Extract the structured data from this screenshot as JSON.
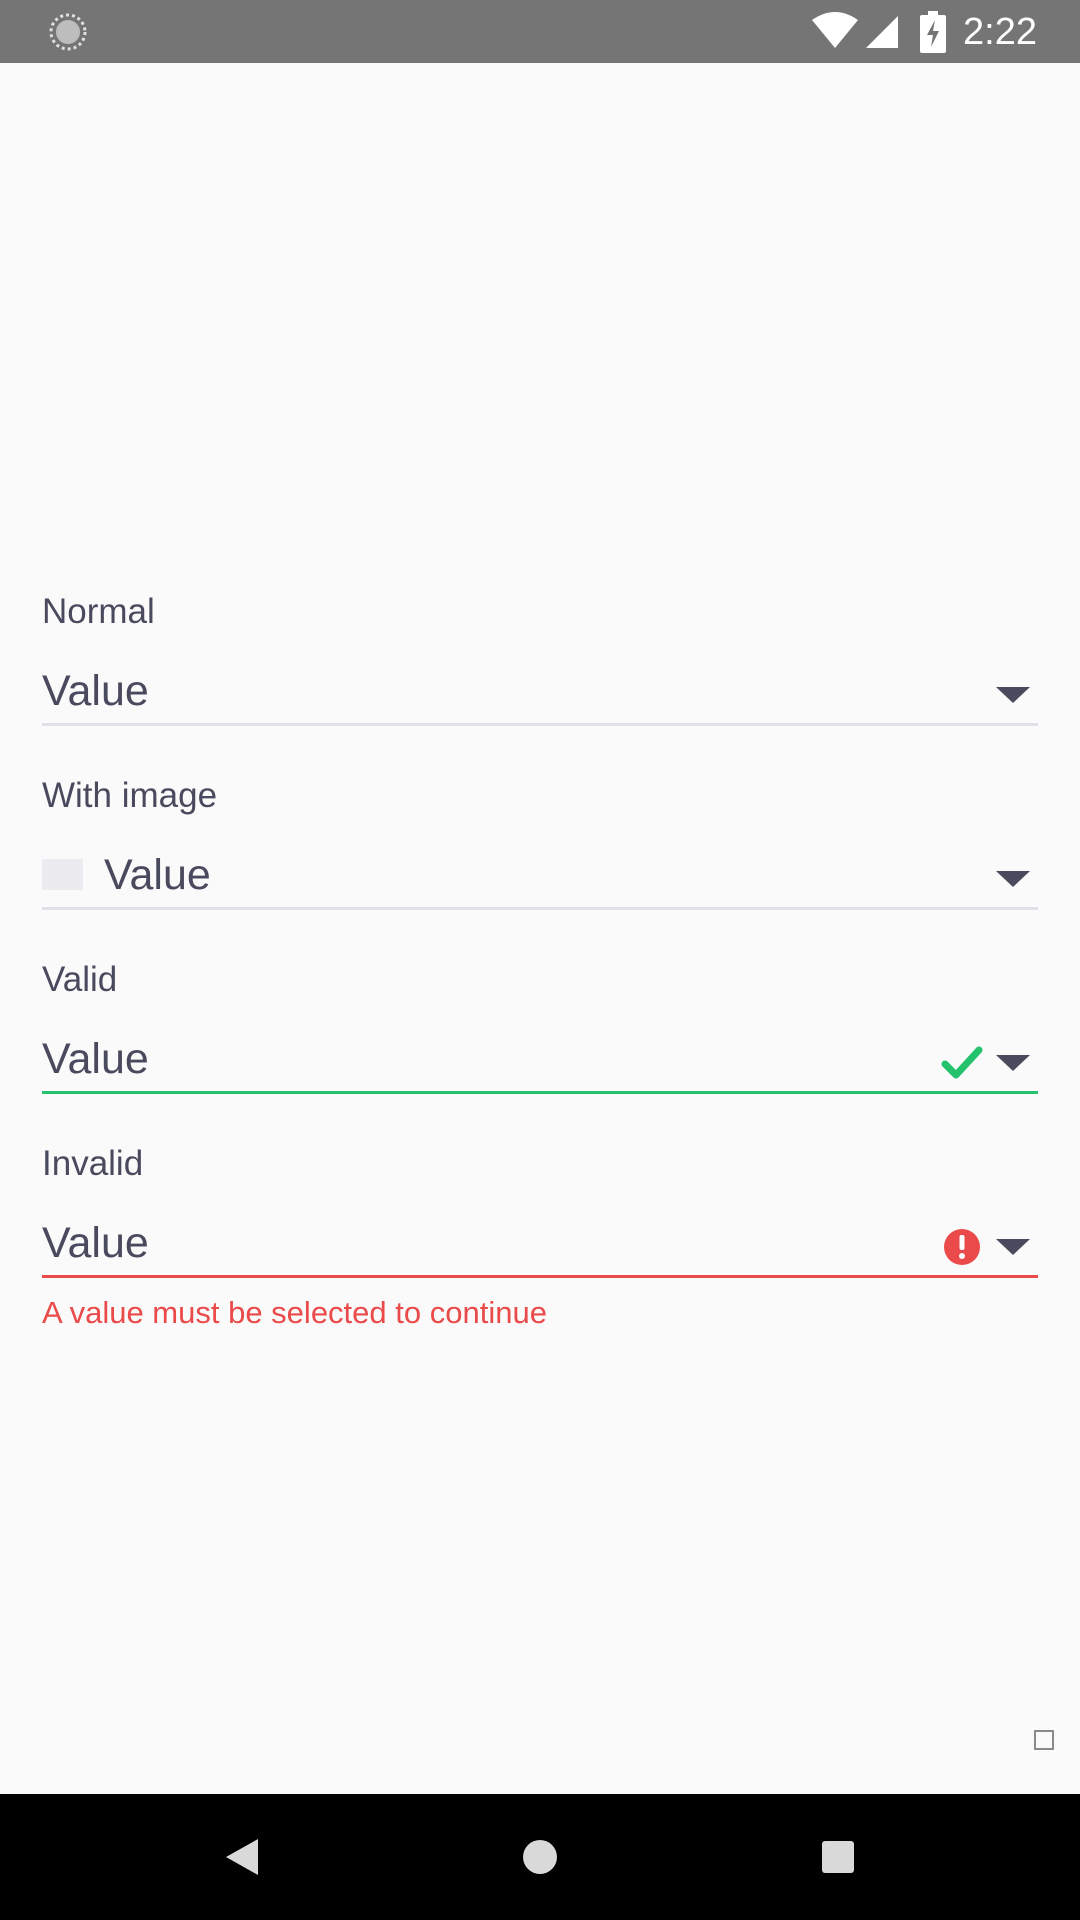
{
  "status_bar": {
    "time": "2:22",
    "icons": [
      "loading-spinner-icon",
      "wifi-icon",
      "cell-signal-icon",
      "battery-charging-icon"
    ]
  },
  "fields": {
    "normal": {
      "label": "Normal",
      "value": "Value",
      "icon": "chevron-down-icon"
    },
    "with_image": {
      "label": "With image",
      "value": "Value",
      "icon": "chevron-down-icon"
    },
    "valid": {
      "label": "Valid",
      "value": "Value",
      "status_icon": "checkmark-icon",
      "icon": "chevron-down-icon"
    },
    "invalid": {
      "label": "Invalid",
      "value": "Value",
      "status_icon": "error-icon",
      "icon": "chevron-down-icon",
      "error_message": "A value must be selected to continue"
    }
  },
  "colors": {
    "text": "#4a4a5e",
    "divider": "#e1e1e7",
    "valid": "#25c26e",
    "error": "#ea4a4a",
    "status_bar": "#757575",
    "nav_bar": "#000000",
    "background": "#fafafa"
  },
  "nav_bar": {
    "buttons": [
      "back-icon",
      "home-icon",
      "recents-icon"
    ]
  }
}
